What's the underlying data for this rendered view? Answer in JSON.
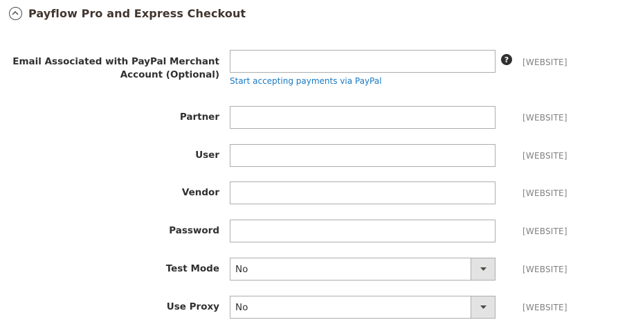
{
  "section": {
    "title": "Payflow Pro and Express Checkout",
    "icon": "collapse-circle-up-icon"
  },
  "fields": [
    {
      "label_line1": "Email Associated with PayPal Merchant",
      "label_line2": "Account (Optional)",
      "value": "",
      "scope": "[WEBSITE]",
      "help": "?",
      "link": "Start accepting payments via PayPal"
    },
    {
      "label": "Partner",
      "value": "",
      "scope": "[WEBSITE]"
    },
    {
      "label": "User",
      "value": "",
      "scope": "[WEBSITE]"
    },
    {
      "label": "Vendor",
      "value": "",
      "scope": "[WEBSITE]"
    },
    {
      "label": "Password",
      "value": "",
      "scope": "[WEBSITE]"
    },
    {
      "label": "Test Mode",
      "selected": "No",
      "scope": "[WEBSITE]"
    },
    {
      "label": "Use Proxy",
      "selected": "No",
      "scope": "[WEBSITE]"
    }
  ]
}
